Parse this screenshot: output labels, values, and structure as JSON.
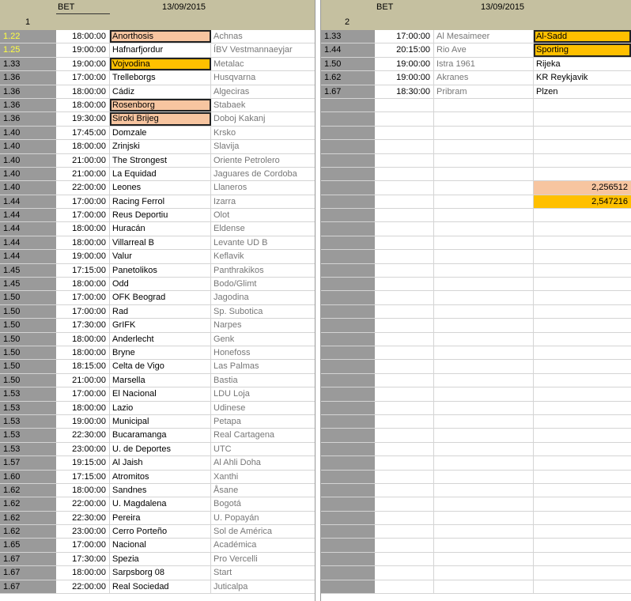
{
  "sheet1": {
    "row_label": "1",
    "bet_label": "BET",
    "date": "13/09/2015",
    "rows": [
      {
        "odds": "1.22",
        "time": "18:00:00",
        "home": "Anorthosis",
        "away": "Achnas",
        "odds_color": "yellow",
        "home_hl": "peach"
      },
      {
        "odds": "1.25",
        "time": "19:00:00",
        "home": "Hafnarfjordur",
        "away": "ÍBV Vestmannaeyjar",
        "odds_color": "yellow",
        "home_hl": ""
      },
      {
        "odds": "1.33",
        "time": "19:00:00",
        "home": "Vojvodina",
        "away": "Metalac",
        "odds_color": "",
        "home_hl": "orange"
      },
      {
        "odds": "1.36",
        "time": "17:00:00",
        "home": "Trelleborgs",
        "away": "Husqvarna",
        "odds_color": "",
        "home_hl": ""
      },
      {
        "odds": "1.36",
        "time": "18:00:00",
        "home": "Cádiz",
        "away": "Algeciras",
        "odds_color": "",
        "home_hl": ""
      },
      {
        "odds": "1.36",
        "time": "18:00:00",
        "home": "Rosenborg",
        "away": "Stabaek",
        "odds_color": "",
        "home_hl": "peach"
      },
      {
        "odds": "1.36",
        "time": "19:30:00",
        "home": "Siroki Brijeg",
        "away": "Doboj Kakanj",
        "odds_color": "",
        "home_hl": "peach"
      },
      {
        "odds": "1.40",
        "time": "17:45:00",
        "home": "Domzale",
        "away": "Krsko",
        "odds_color": "",
        "home_hl": ""
      },
      {
        "odds": "1.40",
        "time": "18:00:00",
        "home": "Zrinjski",
        "away": "Slavija",
        "odds_color": "",
        "home_hl": ""
      },
      {
        "odds": "1.40",
        "time": "21:00:00",
        "home": "The Strongest",
        "away": "Oriente Petrolero",
        "odds_color": "",
        "home_hl": ""
      },
      {
        "odds": "1.40",
        "time": "21:00:00",
        "home": "La Equidad",
        "away": "Jaguares de Cordoba",
        "odds_color": "",
        "home_hl": ""
      },
      {
        "odds": "1.40",
        "time": "22:00:00",
        "home": "Leones",
        "away": "Llaneros",
        "odds_color": "",
        "home_hl": ""
      },
      {
        "odds": "1.44",
        "time": "17:00:00",
        "home": "Racing Ferrol",
        "away": "Izarra",
        "odds_color": "",
        "home_hl": ""
      },
      {
        "odds": "1.44",
        "time": "17:00:00",
        "home": "Reus Deportiu",
        "away": "Olot",
        "odds_color": "",
        "home_hl": ""
      },
      {
        "odds": "1.44",
        "time": "18:00:00",
        "home": "Huracán",
        "away": "Eldense",
        "odds_color": "",
        "home_hl": ""
      },
      {
        "odds": "1.44",
        "time": "18:00:00",
        "home": "Villarreal B",
        "away": "Levante UD B",
        "odds_color": "",
        "home_hl": ""
      },
      {
        "odds": "1.44",
        "time": "19:00:00",
        "home": "Valur",
        "away": "Keflavik",
        "odds_color": "",
        "home_hl": ""
      },
      {
        "odds": "1.45",
        "time": "17:15:00",
        "home": "Panetolikos",
        "away": "Panthrakikos",
        "odds_color": "",
        "home_hl": ""
      },
      {
        "odds": "1.45",
        "time": "18:00:00",
        "home": "Odd",
        "away": "Bodo/Glimt",
        "odds_color": "",
        "home_hl": ""
      },
      {
        "odds": "1.50",
        "time": "17:00:00",
        "home": "OFK Beograd",
        "away": "Jagodina",
        "odds_color": "",
        "home_hl": ""
      },
      {
        "odds": "1.50",
        "time": "17:00:00",
        "home": "Rad",
        "away": "Sp. Subotica",
        "odds_color": "",
        "home_hl": ""
      },
      {
        "odds": "1.50",
        "time": "17:30:00",
        "home": "GrIFK",
        "away": "Narpes",
        "odds_color": "",
        "home_hl": ""
      },
      {
        "odds": "1.50",
        "time": "18:00:00",
        "home": "Anderlecht",
        "away": "Genk",
        "odds_color": "",
        "home_hl": ""
      },
      {
        "odds": "1.50",
        "time": "18:00:00",
        "home": "Bryne",
        "away": "Honefoss",
        "odds_color": "",
        "home_hl": ""
      },
      {
        "odds": "1.50",
        "time": "18:15:00",
        "home": "Celta de Vigo",
        "away": "Las Palmas",
        "odds_color": "",
        "home_hl": ""
      },
      {
        "odds": "1.50",
        "time": "21:00:00",
        "home": "Marsella",
        "away": "Bastia",
        "odds_color": "",
        "home_hl": ""
      },
      {
        "odds": "1.53",
        "time": "17:00:00",
        "home": "El Nacional",
        "away": "LDU Loja",
        "odds_color": "",
        "home_hl": ""
      },
      {
        "odds": "1.53",
        "time": "18:00:00",
        "home": "Lazio",
        "away": "Udinese",
        "odds_color": "",
        "home_hl": ""
      },
      {
        "odds": "1.53",
        "time": "19:00:00",
        "home": "Municipal",
        "away": "Petapa",
        "odds_color": "",
        "home_hl": ""
      },
      {
        "odds": "1.53",
        "time": "22:30:00",
        "home": "Bucaramanga",
        "away": "Real Cartagena",
        "odds_color": "",
        "home_hl": ""
      },
      {
        "odds": "1.53",
        "time": "23:00:00",
        "home": "U. de Deportes",
        "away": "UTC",
        "odds_color": "",
        "home_hl": ""
      },
      {
        "odds": "1.57",
        "time": "19:15:00",
        "home": "Al Jaish",
        "away": "Al Ahli Doha",
        "odds_color": "",
        "home_hl": ""
      },
      {
        "odds": "1.60",
        "time": "17:15:00",
        "home": "Atromitos",
        "away": "Xanthi",
        "odds_color": "",
        "home_hl": ""
      },
      {
        "odds": "1.62",
        "time": "18:00:00",
        "home": "Sandnes",
        "away": "Åsane",
        "odds_color": "",
        "home_hl": ""
      },
      {
        "odds": "1.62",
        "time": "22:00:00",
        "home": "U. Magdalena",
        "away": "Bogotá",
        "odds_color": "",
        "home_hl": ""
      },
      {
        "odds": "1.62",
        "time": "22:30:00",
        "home": "Pereira",
        "away": "U. Popayán",
        "odds_color": "",
        "home_hl": ""
      },
      {
        "odds": "1.62",
        "time": "23:00:00",
        "home": "Cerro Porteño",
        "away": "Sol de América",
        "odds_color": "",
        "home_hl": ""
      },
      {
        "odds": "1.65",
        "time": "17:00:00",
        "home": "Nacional",
        "away": "Académica",
        "odds_color": "",
        "home_hl": ""
      },
      {
        "odds": "1.67",
        "time": "17:30:00",
        "home": "Spezia",
        "away": "Pro Vercelli",
        "odds_color": "",
        "home_hl": ""
      },
      {
        "odds": "1.67",
        "time": "18:00:00",
        "home": "Sarpsborg 08",
        "away": "Start",
        "odds_color": "",
        "home_hl": ""
      },
      {
        "odds": "1.67",
        "time": "22:00:00",
        "home": "Real Sociedad",
        "away": "Juticalpa",
        "odds_color": "",
        "home_hl": ""
      }
    ]
  },
  "sheet2": {
    "row_label": "2",
    "bet_label": "BET",
    "date": "13/09/2015",
    "rows": [
      {
        "odds": "1.33",
        "time": "17:00:00",
        "home": "Al Mesaimeer",
        "away": "Al-Sadd",
        "away_hl": "orange"
      },
      {
        "odds": "1.44",
        "time": "20:15:00",
        "home": "Rio Ave",
        "away": "Sporting",
        "away_hl": "orange"
      },
      {
        "odds": "1.50",
        "time": "19:00:00",
        "home": "Istra 1961",
        "away": "Rijeka",
        "away_hl": ""
      },
      {
        "odds": "1.62",
        "time": "19:00:00",
        "home": "Akranes",
        "away": "KR Reykjavik",
        "away_hl": ""
      },
      {
        "odds": "1.67",
        "time": "18:30:00",
        "home": "Pribram",
        "away": "Plzen",
        "away_hl": ""
      }
    ],
    "totals": [
      {
        "value": "2,256512",
        "color": "peach"
      },
      {
        "value": "2,547216",
        "color": "orange"
      }
    ],
    "total_rows": 41,
    "totals_start_row": 11
  },
  "colors": {
    "header_bg": "#c5c0a0",
    "odds_col_bg": "#9a9a9a",
    "orange": "#ffc000",
    "peach": "#f7c5a0",
    "yellow_text": "#ffff40"
  }
}
